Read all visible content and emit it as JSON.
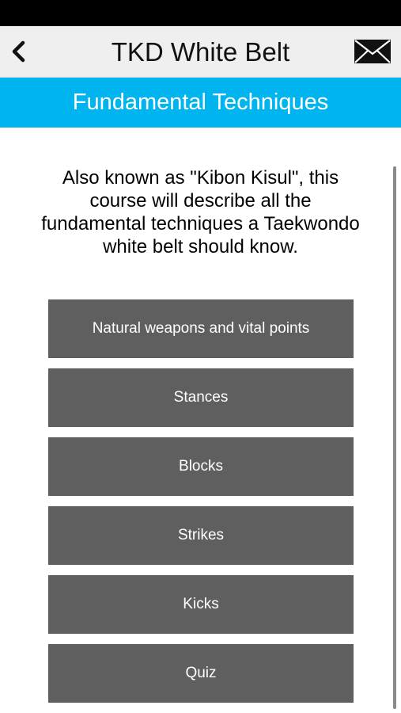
{
  "nav": {
    "title": "TKD White Belt",
    "back_icon": "chevron-left-icon",
    "mail_icon": "envelope-icon"
  },
  "section": {
    "title": "Fundamental Techniques",
    "color": "#00b4f0"
  },
  "description": "Also known as \"Kibon Kisul\", this course will describe all the fundamental techniques a Taekwondo white belt should know.",
  "menu": {
    "button_color": "#5f5f5f",
    "items": [
      {
        "label": "Natural weapons and vital points"
      },
      {
        "label": "Stances"
      },
      {
        "label": "Blocks"
      },
      {
        "label": "Strikes"
      },
      {
        "label": "Kicks"
      },
      {
        "label": "Quiz"
      }
    ]
  }
}
